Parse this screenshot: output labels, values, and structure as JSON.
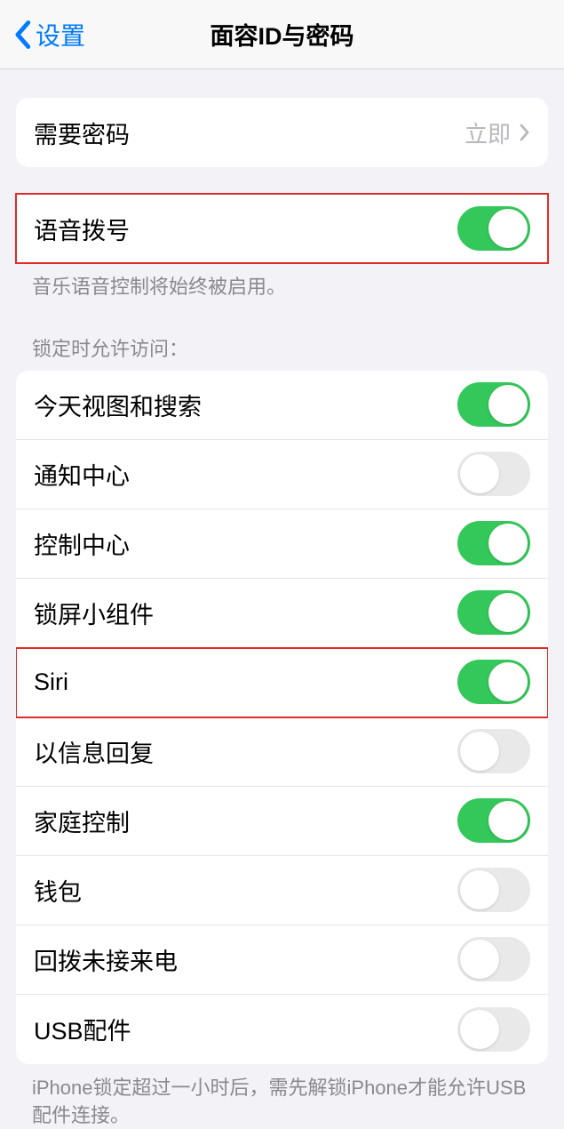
{
  "header": {
    "back_label": "设置",
    "title": "面容ID与密码"
  },
  "passcode": {
    "label": "需要密码",
    "value": "立即"
  },
  "voice": {
    "label": "语音拨号",
    "on": true,
    "footer": "音乐语音控制将始终被启用。"
  },
  "lock_header": "锁定时允许访问：",
  "lock_access": [
    {
      "label": "今天视图和搜索",
      "on": true,
      "highlight": false
    },
    {
      "label": "通知中心",
      "on": false,
      "highlight": false
    },
    {
      "label": "控制中心",
      "on": true,
      "highlight": false
    },
    {
      "label": "锁屏小组件",
      "on": true,
      "highlight": false
    },
    {
      "label": "Siri",
      "on": true,
      "highlight": true
    },
    {
      "label": "以信息回复",
      "on": false,
      "highlight": false
    },
    {
      "label": "家庭控制",
      "on": true,
      "highlight": false
    },
    {
      "label": "钱包",
      "on": false,
      "highlight": false
    },
    {
      "label": "回拨未接来电",
      "on": false,
      "highlight": false
    },
    {
      "label": "USB配件",
      "on": false,
      "highlight": false
    }
  ],
  "usb_footer": "iPhone锁定超过一小时后，需先解锁iPhone才能允许USB配件连接。"
}
